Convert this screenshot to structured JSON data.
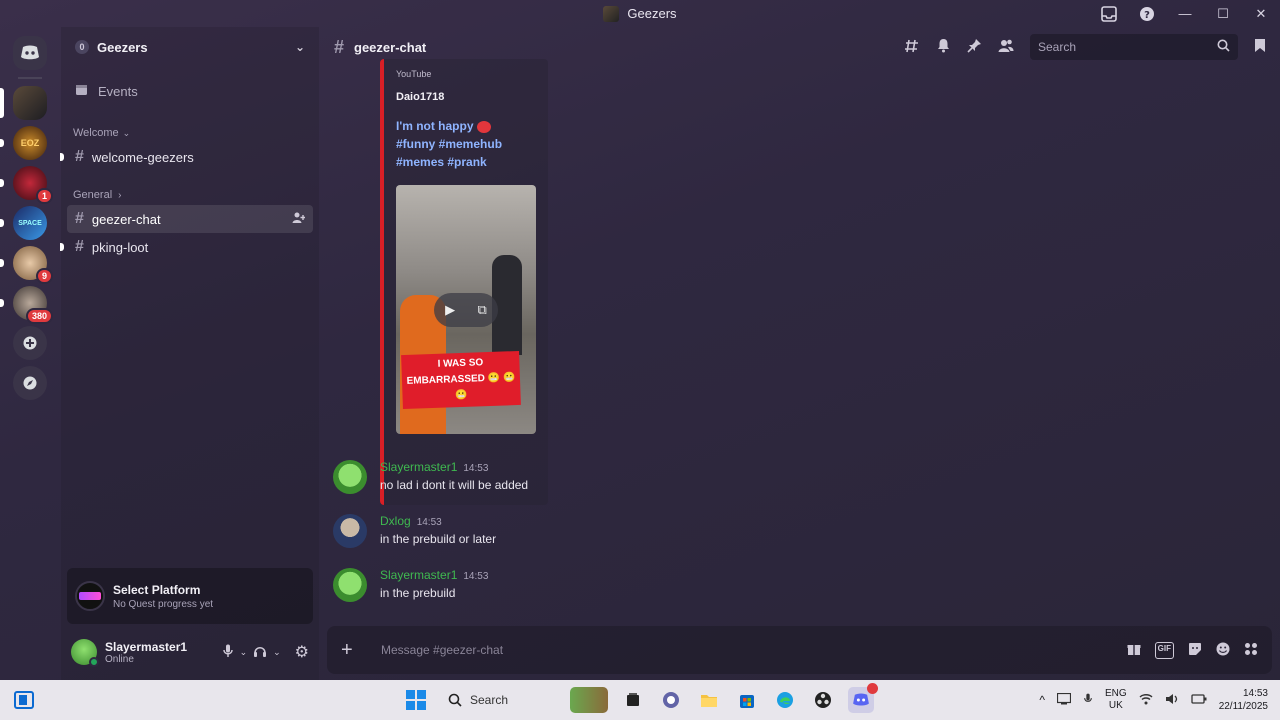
{
  "window": {
    "title": "Geezers"
  },
  "server": {
    "name": "Geezers",
    "notif_count": "0"
  },
  "servers": [
    {
      "badge": ""
    },
    {
      "badge": "",
      "label": "EOZ"
    },
    {
      "badge": "1"
    },
    {
      "badge": "",
      "label": "SPACE"
    },
    {
      "badge": "9"
    },
    {
      "badge": "380"
    }
  ],
  "sidebar": {
    "events_label": "Events",
    "categories": [
      {
        "label": "Welcome",
        "channels": [
          {
            "name": "welcome-geezers"
          }
        ]
      },
      {
        "label": "General",
        "channels": [
          {
            "name": "geezer-chat"
          },
          {
            "name": "pking-loot"
          }
        ]
      }
    ]
  },
  "quest": {
    "title": "Select Platform",
    "subtitle": "No Quest progress yet"
  },
  "user": {
    "name": "Slayermaster1",
    "status": "Online"
  },
  "channel": {
    "name": "geezer-chat"
  },
  "header": {
    "search_placeholder": "Search"
  },
  "embed": {
    "provider": "YouTube",
    "author": "Daio1718",
    "title_line1": "I'm not happy",
    "title_line2": "#funny #memehub",
    "title_line3": "#memes #prank",
    "caption": "I WAS SO EMBARRASSED 😬 😬 😬"
  },
  "messages": [
    {
      "author": "Slayermaster1",
      "time": "14:53",
      "text": "no lad i dont it will be added"
    },
    {
      "author": "Dxlog",
      "time": "14:53",
      "text": "in the prebuild or later"
    },
    {
      "author": "Slayermaster1",
      "time": "14:53",
      "text": "in the prebuild"
    }
  ],
  "composer": {
    "placeholder": "Message #geezer-chat",
    "gif_label": "GIF"
  },
  "taskbar": {
    "search_label": "Search",
    "lang_line1": "ENG",
    "lang_line2": "UK",
    "time": "14:53",
    "date": "22/11/2025"
  }
}
